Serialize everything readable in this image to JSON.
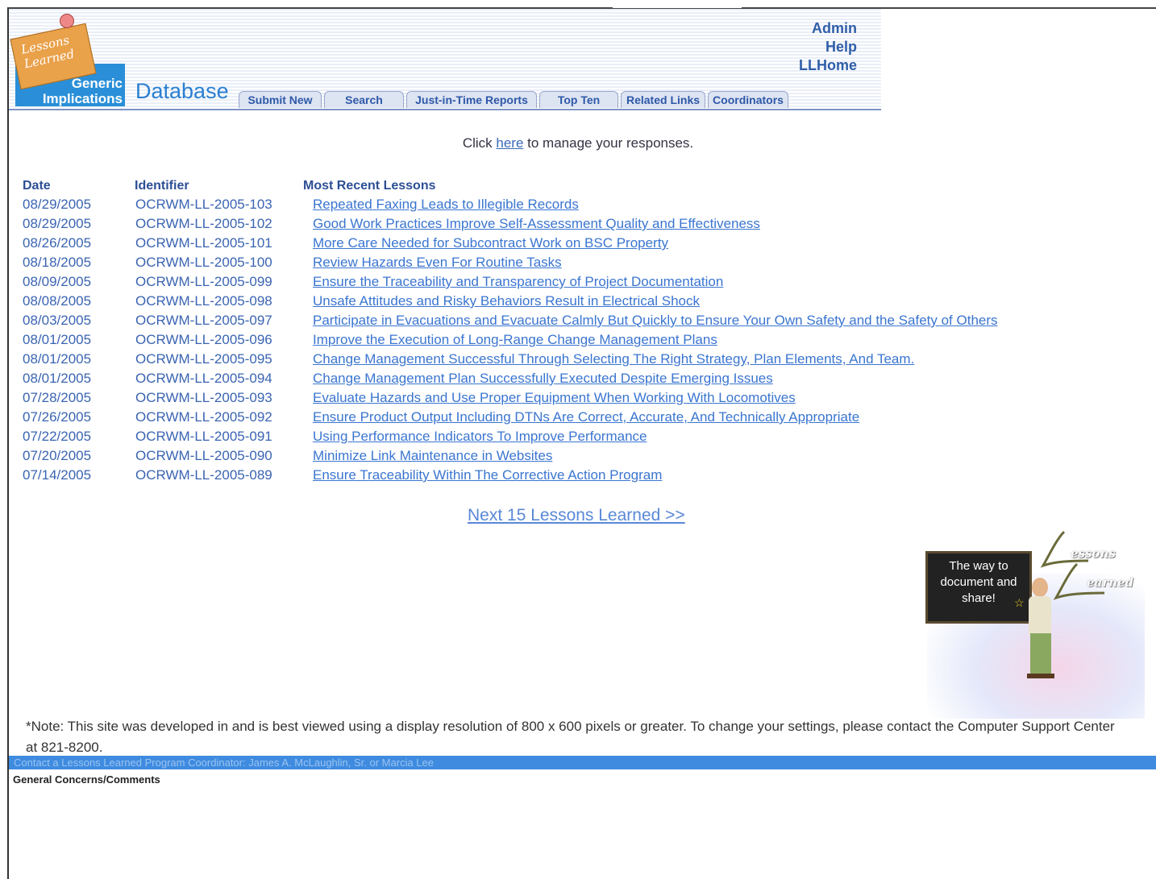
{
  "header": {
    "logo_card_text": "Lessons Learned",
    "logo_text_line1": "Generic",
    "logo_text_line2": "Implications",
    "db_title": "Database",
    "top_links": [
      "Admin",
      "Help",
      "LLHome"
    ]
  },
  "tabs": [
    {
      "label": "Submit New"
    },
    {
      "label": "Search"
    },
    {
      "label": "Just-in-Time Reports"
    },
    {
      "label": "Top Ten"
    },
    {
      "label": "Related Links"
    },
    {
      "label": "Coordinators"
    }
  ],
  "manage": {
    "prefix": "Click ",
    "link": "here",
    "suffix": " to manage your responses."
  },
  "table": {
    "headers": {
      "date": "Date",
      "identifier": "Identifier",
      "lesson": "Most Recent Lessons"
    },
    "rows": [
      {
        "date": "08/29/2005",
        "id": "OCRWM-LL-2005-103",
        "lesson": "Repeated Faxing Leads to Illegible Records"
      },
      {
        "date": "08/29/2005",
        "id": "OCRWM-LL-2005-102",
        "lesson": "Good Work Practices Improve Self-Assessment Quality and Effectiveness"
      },
      {
        "date": "08/26/2005",
        "id": "OCRWM-LL-2005-101",
        "lesson": "More Care Needed for Subcontract Work on BSC Property"
      },
      {
        "date": "08/18/2005",
        "id": "OCRWM-LL-2005-100",
        "lesson": "Review Hazards Even For Routine Tasks"
      },
      {
        "date": "08/09/2005",
        "id": "OCRWM-LL-2005-099",
        "lesson": "Ensure the Traceability and Transparency of Project Documentation"
      },
      {
        "date": "08/08/2005",
        "id": "OCRWM-LL-2005-098",
        "lesson": "Unsafe Attitudes and Risky Behaviors Result in Electrical Shock"
      },
      {
        "date": "08/03/2005",
        "id": "OCRWM-LL-2005-097",
        "lesson": "Participate in Evacuations and Evacuate Calmly But Quickly to Ensure Your Own Safety and the Safety of Others"
      },
      {
        "date": "08/01/2005",
        "id": "OCRWM-LL-2005-096",
        "lesson": "Improve the Execution of Long-Range Change Management Plans"
      },
      {
        "date": "08/01/2005",
        "id": "OCRWM-LL-2005-095",
        "lesson": "Change Management Successful Through Selecting The Right Strategy, Plan Elements, And Team."
      },
      {
        "date": "08/01/2005",
        "id": "OCRWM-LL-2005-094",
        "lesson": "Change Management Plan Successfully Executed Despite Emerging Issues"
      },
      {
        "date": "07/28/2005",
        "id": "OCRWM-LL-2005-093",
        "lesson": "Evaluate Hazards and Use Proper Equipment When Working With Locomotives"
      },
      {
        "date": "07/26/2005",
        "id": "OCRWM-LL-2005-092",
        "lesson": "Ensure Product Output Including DTNs Are Correct, Accurate, And Technically Appropriate"
      },
      {
        "date": "07/22/2005",
        "id": "OCRWM-LL-2005-091",
        "lesson": "Using Performance Indicators To Improve Performance"
      },
      {
        "date": "07/20/2005",
        "id": "OCRWM-LL-2005-090",
        "lesson": "Minimize Link Maintenance in Websites"
      },
      {
        "date": "07/14/2005",
        "id": "OCRWM-LL-2005-089",
        "lesson": "Ensure Traceability Within The Corrective Action Program"
      }
    ]
  },
  "next_link": "Next 15 Lessons Learned >>",
  "illustration": {
    "board_text_1": "The way to",
    "board_text_2": "document and",
    "board_text_3": "share!",
    "word_1": "essons",
    "word_2": "earned"
  },
  "note": "*Note: This site was developed in and is best viewed using a display resolution of 800 x 600 pixels or greater. To change your settings, please contact the Computer Support Center at 821-8200.",
  "footer_bar": "Contact a Lessons Learned Program Coordinator:  James A. McLaughlin, Sr. or Marcia Lee",
  "concerns": "General Concerns/Comments"
}
